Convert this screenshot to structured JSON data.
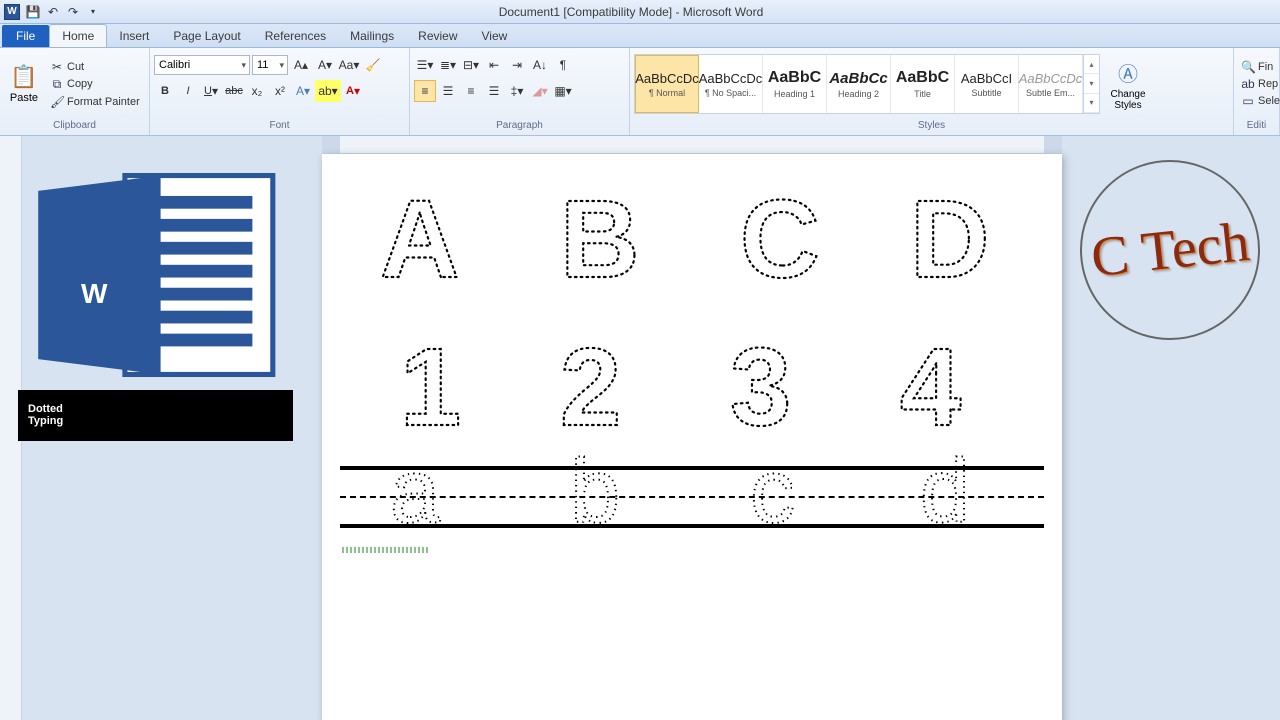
{
  "title": "Document1 [Compatibility Mode] - Microsoft Word",
  "tabs": {
    "file": "File",
    "home": "Home",
    "insert": "Insert",
    "pagelayout": "Page Layout",
    "references": "References",
    "mailings": "Mailings",
    "review": "Review",
    "view": "View"
  },
  "clipboard": {
    "label": "Clipboard",
    "paste": "Paste",
    "cut": "Cut",
    "copy": "Copy",
    "fmt": "Format Painter"
  },
  "font": {
    "label": "Font",
    "name": "Calibri",
    "size": "11"
  },
  "paragraph": {
    "label": "Paragraph"
  },
  "styles": {
    "label": "Styles",
    "items": [
      {
        "prev": "AaBbCcDc",
        "name": "¶ Normal",
        "sel": true
      },
      {
        "prev": "AaBbCcDc",
        "name": "¶ No Spaci..."
      },
      {
        "prev": "AaBbC",
        "name": "Heading 1",
        "big": true
      },
      {
        "prev": "AaBbCc",
        "name": "Heading 2",
        "it": true
      },
      {
        "prev": "AaBbC",
        "name": "Title",
        "big": true
      },
      {
        "prev": "AaBbCcI",
        "name": "Subtitle"
      },
      {
        "prev": "AaBbCcDc",
        "name": "Subtle Em...",
        "gray": true
      }
    ],
    "change": "Change Styles"
  },
  "editing": {
    "label": "Editi",
    "find": "Fin",
    "replace": "Rep",
    "select": "Sele"
  },
  "doc": {
    "row1": [
      "A",
      "B",
      "C",
      "D"
    ],
    "row2": [
      "1",
      "2",
      "3",
      "4"
    ],
    "row3": [
      "a",
      "b",
      "c",
      "d"
    ]
  },
  "overlay": {
    "line1": "Dotted",
    "line2": "Typing",
    "circle": "C Tech"
  }
}
